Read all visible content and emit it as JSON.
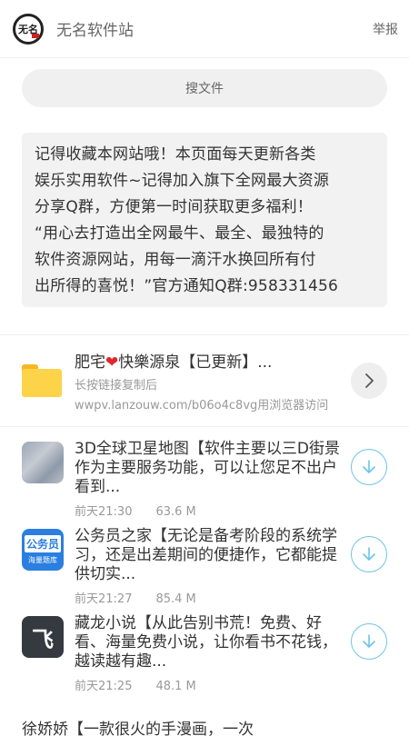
{
  "header": {
    "logo_text": "无名",
    "title": "无名软件站",
    "report_label": "举报"
  },
  "search": {
    "label": "搜文件"
  },
  "notice": {
    "lines": [
      "记得收藏本网站哦！本页面每天更新各类",
      "娱乐实用软件~记得加入旗下全网最大资源",
      "分享Q群，方便第一时间获取更多福利！",
      "“用心去打造出全网最牛、最全、最独特的",
      "软件资源网站，用每一滴汗水换回所有付",
      "出所得的喜悦！”官方通知Q群:958331456"
    ]
  },
  "folder": {
    "title_prefix": "肥宅",
    "title_suffix": "快樂源泉【已更新】...",
    "subtitle": "长按链接复制后",
    "url": "wwpv.lanzouw.com/b06o4c8vg用浏览器访问"
  },
  "files": [
    {
      "thumb": "blur",
      "thumb_text": "",
      "title": "3D全球卫星地图【软件主要以三D街景作为主要服务功能，可以让您足不出户看到...",
      "date": "前天21:30",
      "size": "63.6 M"
    },
    {
      "thumb": "gwy",
      "thumb_text": "公务员",
      "thumb_sub": "海量题库",
      "title": "公务员之家【无论是备考阶段的系统学习，还是出差期间的便捷作，它都能提供切实...",
      "date": "前天21:27",
      "size": "85.4 M"
    },
    {
      "thumb": "zl",
      "thumb_text": "飞",
      "title": "藏龙小说【从此告别书荒！免费、好看、海量免费小说，让你看书不花钱，越读越有趣...",
      "date": "前天21:25",
      "size": "48.1 M"
    }
  ],
  "partial_row": "徐娇娇【一款很火的手漫画，一次",
  "colors": {
    "accent": "#6cc4ea",
    "folder": "#fdd34a",
    "heart": "#e0272b"
  },
  "icons": {
    "chevron": "chevron-right-icon",
    "download": "download-icon",
    "heart": "heart-icon"
  }
}
